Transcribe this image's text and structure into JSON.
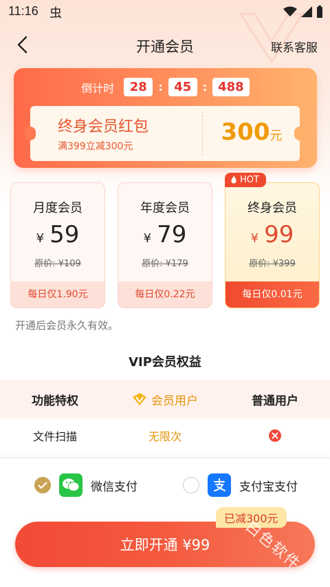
{
  "status_bar": {
    "time": "11:16",
    "app_glyph": "虫"
  },
  "nav": {
    "title": "开通会员",
    "service_label": "联系客服"
  },
  "promo": {
    "countdown_label": "倒计时",
    "countdown": {
      "h": "28",
      "m": "45",
      "ms": "488"
    },
    "coupon_title": "终身会员红包",
    "coupon_sub": "满399立减300元",
    "coupon_amount": "300",
    "coupon_unit": "元"
  },
  "plans": [
    {
      "name": "月度会员",
      "currency": "¥",
      "price": "59",
      "original": "原价: ¥109",
      "daily": "每日仅1.90元",
      "selected": false
    },
    {
      "name": "年度会员",
      "currency": "¥",
      "price": "79",
      "original": "原价: ¥179",
      "daily": "每日仅0.22元",
      "selected": false
    },
    {
      "name": "终身会员",
      "currency": "¥",
      "price": "99",
      "original": "原价: ¥399",
      "daily": "每日仅0.01元",
      "selected": true,
      "badge": "HOT"
    }
  ],
  "validity_note": "开通后会员永久有效。",
  "benefits": {
    "title": "VIP会员权益",
    "headers": [
      "功能特权",
      "会员用户",
      "普通用户"
    ],
    "rows": [
      {
        "feature": "文件扫描",
        "vip": "无限次",
        "normal": "x-mark-icon"
      }
    ]
  },
  "payment": {
    "options": [
      {
        "label": "微信支付",
        "icon": "wechat-icon",
        "checked": true
      },
      {
        "label": "支付宝支付",
        "icon": "alipay-icon",
        "checked": false
      }
    ],
    "discount_tag": "已减300元",
    "cta_label": "立即开通 ¥99"
  },
  "watermark": "白色软件",
  "colors": {
    "accent": "#f24a37",
    "gold": "#e6940b",
    "radio_checked": "#c9a253"
  }
}
